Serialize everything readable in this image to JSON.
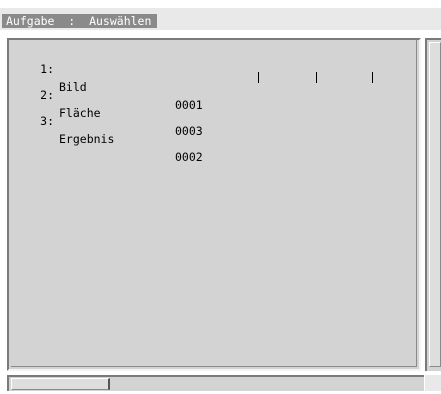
{
  "header": {
    "title": "Aufgabe  :  Auswählen"
  },
  "list": {
    "items": [
      {
        "number": "1:",
        "label": "Bild",
        "code": "0001"
      },
      {
        "number": "2:",
        "label": "Fläche",
        "code": "0003",
        "marks": [
          "|",
          "|",
          "|"
        ]
      },
      {
        "number": "3:",
        "label": "Ergebnis",
        "code": "0002"
      }
    ]
  },
  "colors": {
    "title_bar": "#e9e9e9",
    "title_label_bg": "#8a8a8a",
    "panel_bg": "#d3d3d3",
    "text": "#000000"
  }
}
